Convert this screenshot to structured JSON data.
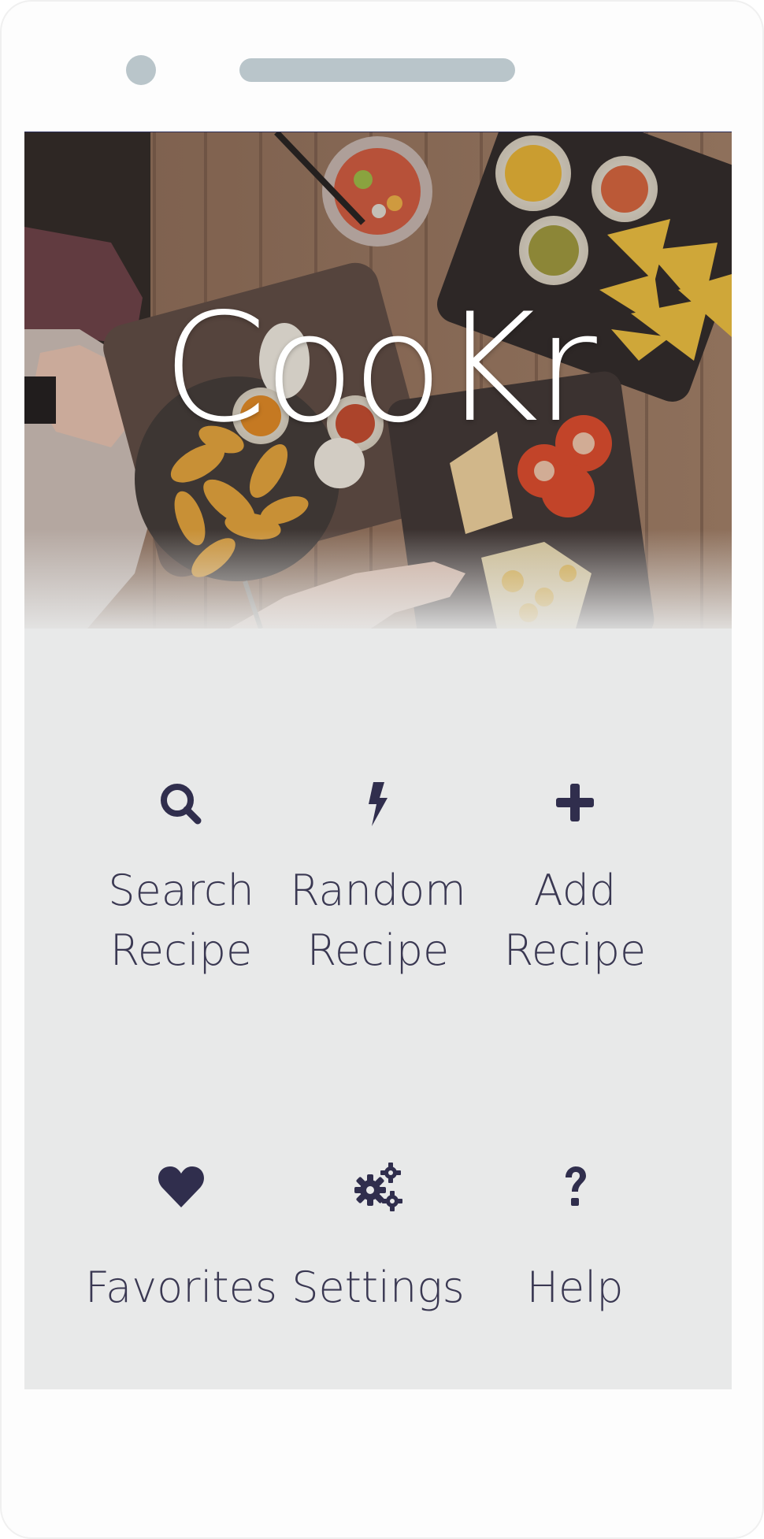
{
  "app": {
    "title": "CooKr"
  },
  "menu": {
    "items": [
      {
        "id": "search",
        "label": "Search\nRecipe",
        "icon": "search-icon"
      },
      {
        "id": "random",
        "label": "Random\nRecipe",
        "icon": "bolt-icon"
      },
      {
        "id": "add",
        "label": "Add\nRecipe",
        "icon": "plus-icon"
      },
      {
        "id": "favorites",
        "label": "Favorites",
        "icon": "heart-icon"
      },
      {
        "id": "settings",
        "label": "Settings",
        "icon": "gears-icon"
      },
      {
        "id": "help",
        "label": "Help",
        "icon": "question-icon"
      }
    ]
  },
  "colors": {
    "icon": "#302e4d",
    "label": "#3a3852",
    "screen_bg": "#e8e9e9",
    "device_accent": "#b9c5ca"
  }
}
